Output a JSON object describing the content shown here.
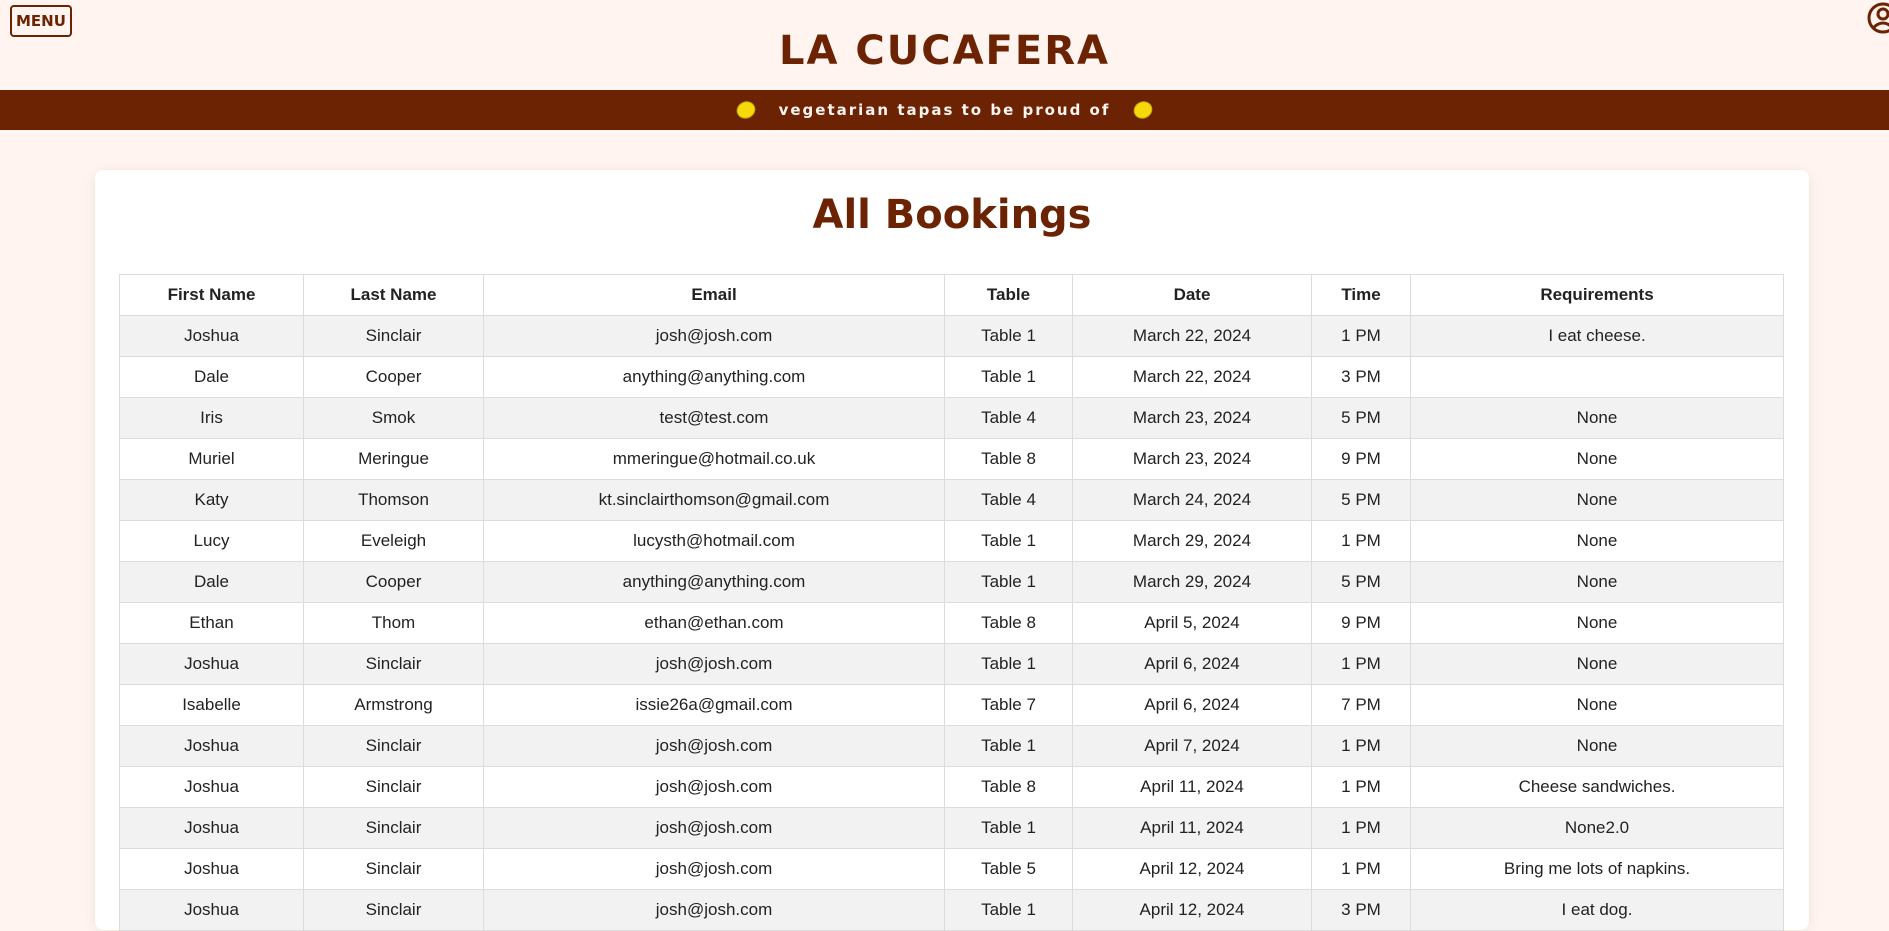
{
  "header": {
    "menu_label": "MENU",
    "brand": "LA CUCAFERA",
    "tagline": "vegetarian tapas to be proud of",
    "account_icon": "account-circle-icon",
    "lemon_icon": "lemon-icon",
    "colors": {
      "brand": "#6b2303",
      "background": "#fff4ef",
      "lemon": "#f5d90a"
    }
  },
  "page": {
    "title": "All Bookings"
  },
  "table": {
    "columns": [
      "First Name",
      "Last Name",
      "Email",
      "Table",
      "Date",
      "Time",
      "Requirements"
    ],
    "rows": [
      [
        "Joshua",
        "Sinclair",
        "josh@josh.com",
        "Table 1",
        "March 22, 2024",
        "1 PM",
        "I eat cheese."
      ],
      [
        "Dale",
        "Cooper",
        "anything@anything.com",
        "Table 1",
        "March 22, 2024",
        "3 PM",
        ""
      ],
      [
        "Iris",
        "Smok",
        "test@test.com",
        "Table 4",
        "March 23, 2024",
        "5 PM",
        "None"
      ],
      [
        "Muriel",
        "Meringue",
        "mmeringue@hotmail.co.uk",
        "Table 8",
        "March 23, 2024",
        "9 PM",
        "None"
      ],
      [
        "Katy",
        "Thomson",
        "kt.sinclairthomson@gmail.com",
        "Table 4",
        "March 24, 2024",
        "5 PM",
        "None"
      ],
      [
        "Lucy",
        "Eveleigh",
        "lucysth@hotmail.com",
        "Table 1",
        "March 29, 2024",
        "1 PM",
        "None"
      ],
      [
        "Dale",
        "Cooper",
        "anything@anything.com",
        "Table 1",
        "March 29, 2024",
        "5 PM",
        "None"
      ],
      [
        "Ethan",
        "Thom",
        "ethan@ethan.com",
        "Table 8",
        "April 5, 2024",
        "9 PM",
        "None"
      ],
      [
        "Joshua",
        "Sinclair",
        "josh@josh.com",
        "Table 1",
        "April 6, 2024",
        "1 PM",
        "None"
      ],
      [
        "Isabelle",
        "Armstrong",
        "issie26a@gmail.com",
        "Table 7",
        "April 6, 2024",
        "7 PM",
        "None"
      ],
      [
        "Joshua",
        "Sinclair",
        "josh@josh.com",
        "Table 1",
        "April 7, 2024",
        "1 PM",
        "None"
      ],
      [
        "Joshua",
        "Sinclair",
        "josh@josh.com",
        "Table 8",
        "April 11, 2024",
        "1 PM",
        "Cheese sandwiches."
      ],
      [
        "Joshua",
        "Sinclair",
        "josh@josh.com",
        "Table 1",
        "April 11, 2024",
        "1 PM",
        "None2.0"
      ],
      [
        "Joshua",
        "Sinclair",
        "josh@josh.com",
        "Table 5",
        "April 12, 2024",
        "1 PM",
        "Bring me lots of napkins."
      ],
      [
        "Joshua",
        "Sinclair",
        "josh@josh.com",
        "Table 1",
        "April 12, 2024",
        "3 PM",
        "I eat dog."
      ]
    ]
  }
}
